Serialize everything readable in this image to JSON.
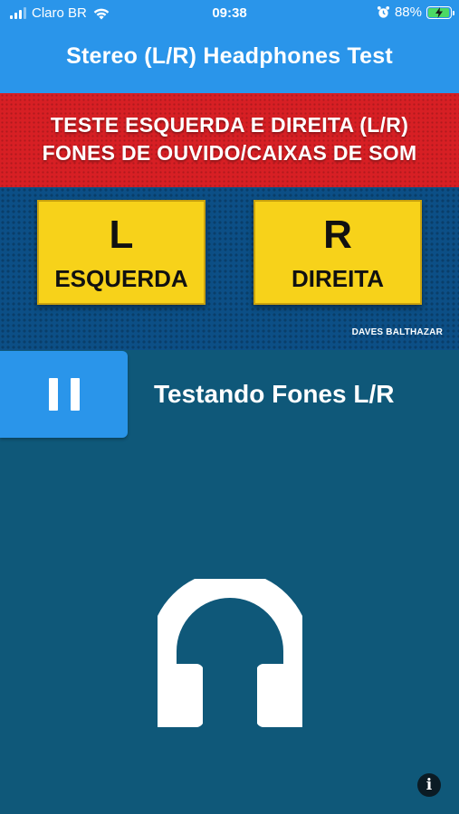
{
  "status_bar": {
    "carrier": "Claro BR",
    "time": "09:38",
    "battery_percent": "88%",
    "icons": [
      "signal-icon",
      "wifi-icon",
      "alarm-icon",
      "battery-charging-icon"
    ]
  },
  "header": {
    "title": "Stereo (L/R) Headphones Test"
  },
  "banner": {
    "line1": "TESTE ESQUERDA E DIREITA (L/R)",
    "line2": "FONES DE OUVIDO/CAIXAS DE SOM",
    "left_letter": "L",
    "left_word": "ESQUERDA",
    "right_letter": "R",
    "right_word": "DIREITA",
    "credit": "DAVES BALTHAZAR"
  },
  "player": {
    "state_icon": "pause-icon",
    "title": "Testando Fones L/R"
  },
  "main": {
    "illustration_icon": "headphones-icon",
    "info_icon": "info-icon"
  },
  "colors": {
    "header_blue": "#2a95ea",
    "background": "#0f5879",
    "banner_red": "#d71f24",
    "banner_yellow": "#f7d21a",
    "battery_green": "#4cd964"
  }
}
